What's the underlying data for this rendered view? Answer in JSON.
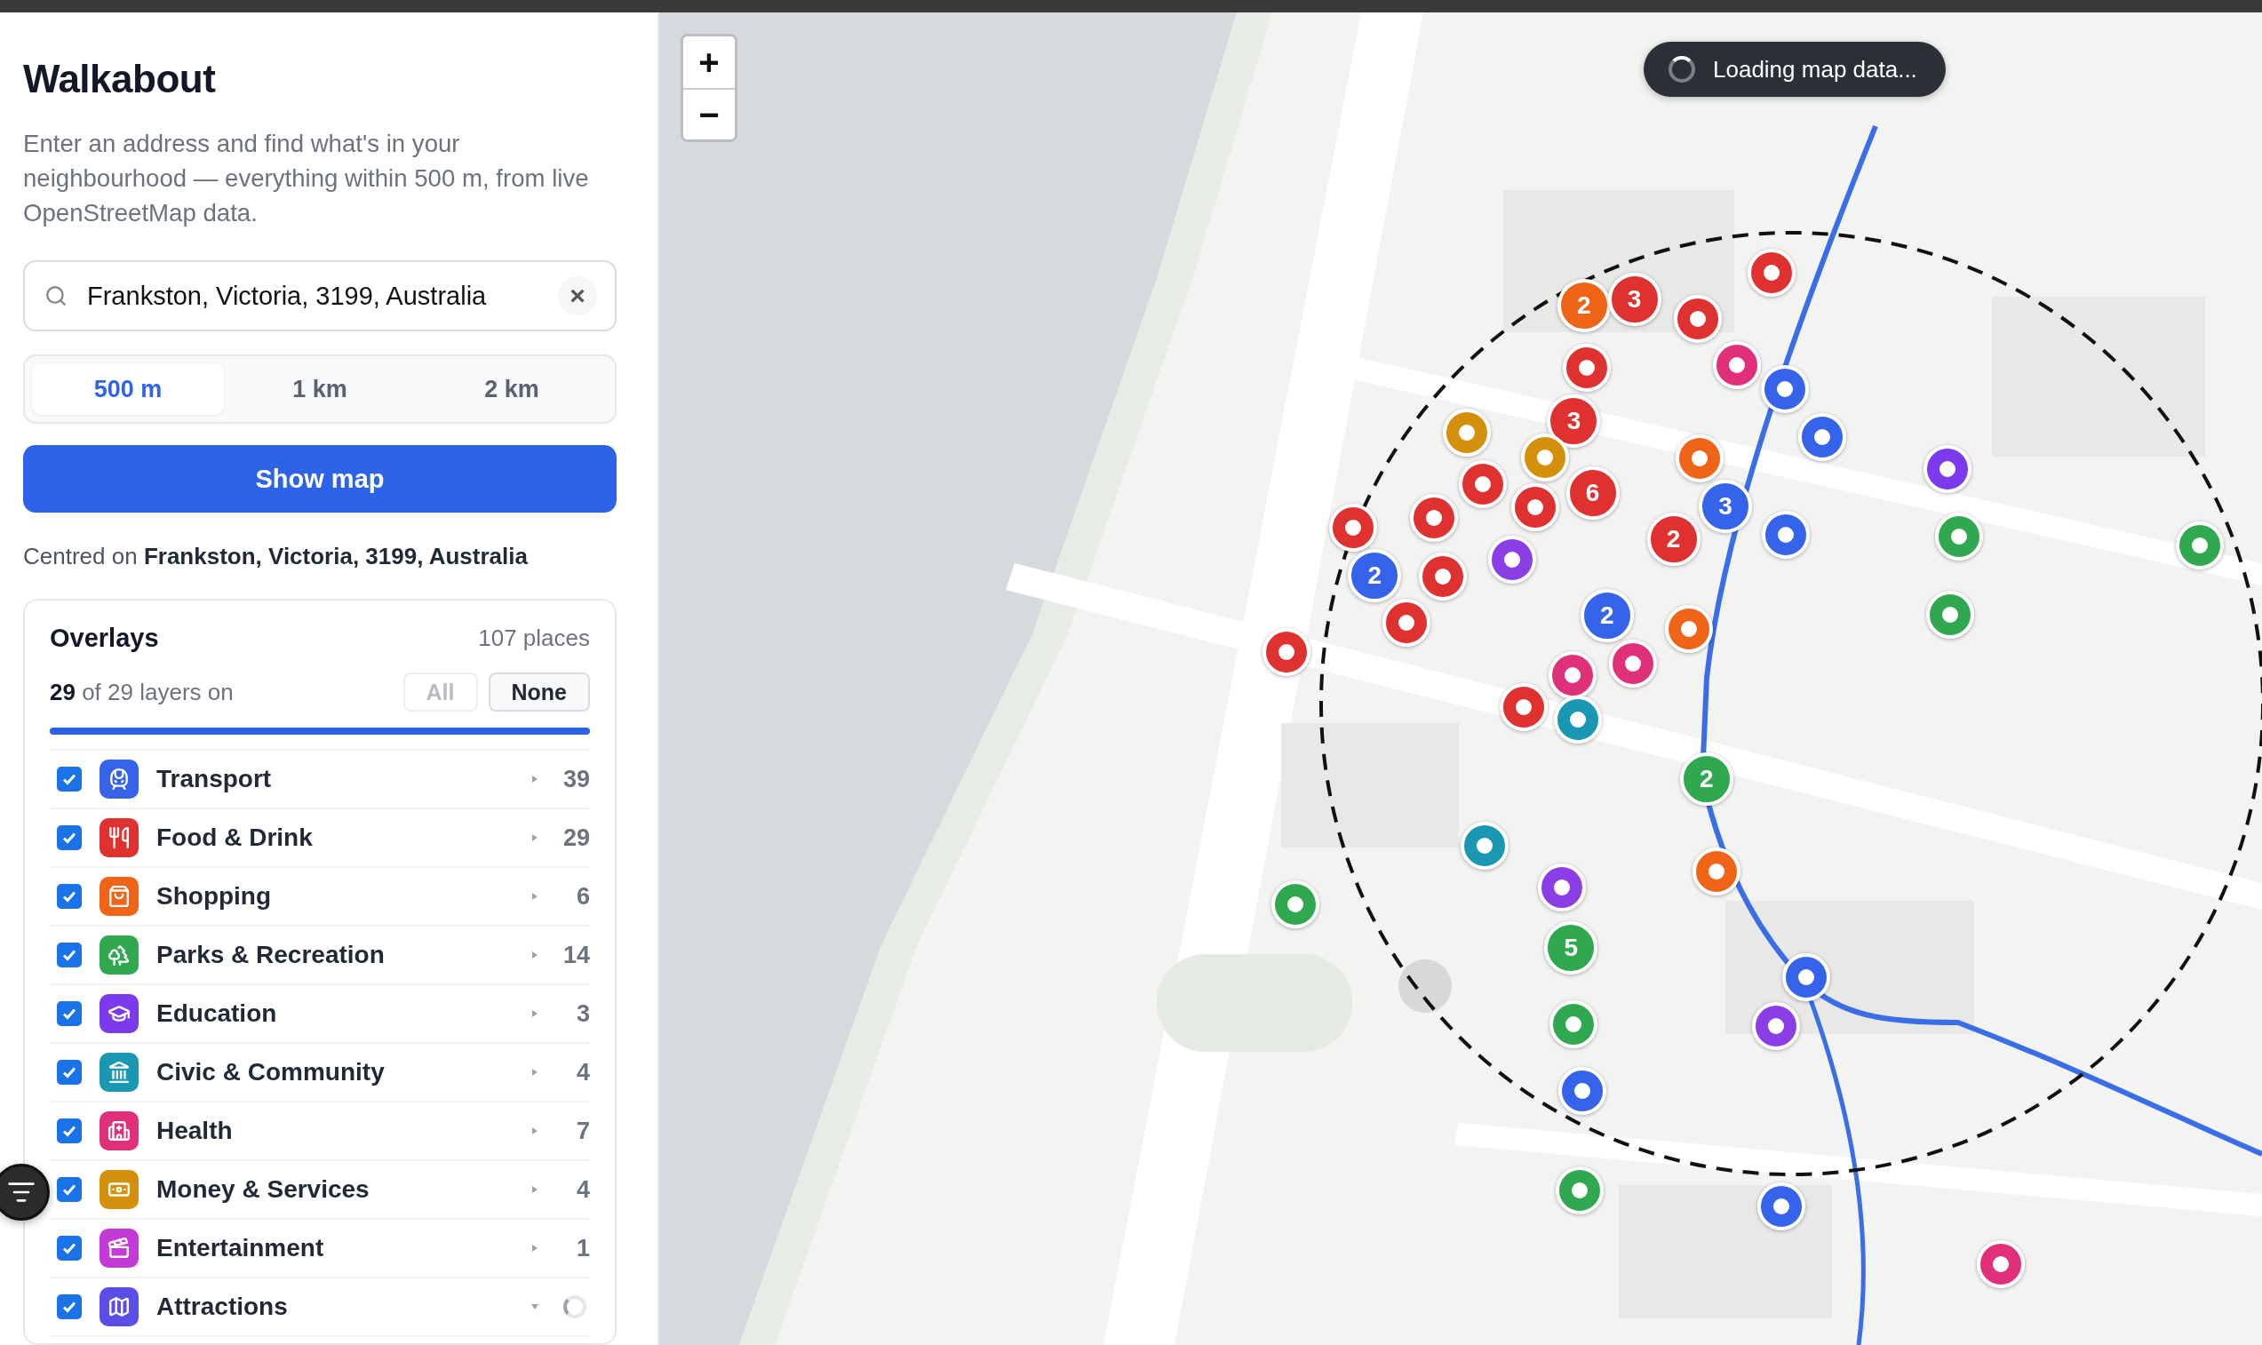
{
  "app": {
    "title": "Walkabout",
    "description": "Enter an address and find what's in your neighbourhood — everything within 500 m, from live OpenStreetMap data."
  },
  "search": {
    "value": "Frankston, Victoria, 3199, Australia",
    "clear": "×"
  },
  "ranges": [
    {
      "label": "500 m",
      "selected": true
    },
    {
      "label": "1 km",
      "selected": false
    },
    {
      "label": "2 km",
      "selected": false
    }
  ],
  "show_button": "Show map",
  "centred": "Centred on **Frankston, Victoria, 3199, Australia**",
  "overlays": {
    "title": "Overlays",
    "count": "107 places",
    "summary": "**29** of 29 layers on",
    "level": 1,
    "buttons": [
      {
        "label": "All",
        "disabled": true
      },
      {
        "label": "None",
        "disabled": false
      }
    ],
    "layers": [
      {
        "name": "Transport",
        "checked": true,
        "expanded": false,
        "count": "39",
        "color": "#3563e9"
      },
      {
        "name": "Food & Drink",
        "checked": true,
        "expanded": false,
        "count": "29",
        "color": "#e03131"
      },
      {
        "name": "Shopping",
        "checked": true,
        "expanded": false,
        "count": "6",
        "color": "#f06418"
      },
      {
        "name": "Parks & Recreation",
        "checked": true,
        "expanded": false,
        "count": "14",
        "color": "#2fa84f"
      },
      {
        "name": "Education",
        "checked": true,
        "expanded": false,
        "count": "3",
        "color": "#7c3aed"
      },
      {
        "name": "Civic & Community",
        "checked": true,
        "expanded": false,
        "count": "4",
        "color": "#1a98b3"
      },
      {
        "name": "Health",
        "checked": true,
        "expanded": false,
        "count": "7",
        "color": "#e0307a"
      },
      {
        "name": "Money & Services",
        "checked": true,
        "expanded": false,
        "count": "4",
        "color": "#d4900b"
      },
      {
        "name": "Entertainment",
        "checked": true,
        "expanded": false,
        "count": "1",
        "color": "#c43ad6"
      },
      {
        "name": "Attractions",
        "checked": true,
        "expanded": true,
        "loading": true,
        "color": "#5b4ee6"
      }
    ]
  },
  "map": {
    "zoom_in": "+",
    "zoom_out": "−",
    "loading": "Loading map data...",
    "markers": [
      {
        "kind": "poi",
        "color": "#e03131"
      },
      {
        "kind": "cluster",
        "count": "2",
        "color": "#f06418"
      },
      {
        "kind": "cluster",
        "count": "3",
        "color": "#e03131"
      },
      {
        "kind": "poi",
        "color": "#e03131"
      },
      {
        "kind": "poi",
        "color": "#e03131"
      },
      {
        "kind": "cluster",
        "count": "3",
        "color": "#e03131"
      },
      {
        "kind": "poi",
        "color": "#e0307a"
      },
      {
        "kind": "poi",
        "color": "#3563e9"
      },
      {
        "kind": "poi",
        "color": "#3563e9"
      },
      {
        "kind": "poi",
        "color": "#d4900b"
      },
      {
        "kind": "poi",
        "color": "#d4900b"
      },
      {
        "kind": "cluster",
        "count": "6",
        "color": "#e03131"
      },
      {
        "kind": "poi",
        "color": "#e03131"
      },
      {
        "kind": "poi",
        "color": "#e03131"
      },
      {
        "kind": "poi",
        "color": "#8b3ee6"
      },
      {
        "kind": "poi",
        "color": "#f06418"
      },
      {
        "kind": "cluster",
        "count": "3",
        "color": "#3563e9"
      },
      {
        "kind": "cluster",
        "count": "2",
        "color": "#e03131"
      },
      {
        "kind": "poi",
        "color": "#3563e9"
      },
      {
        "kind": "poi",
        "color": "#e03131"
      },
      {
        "kind": "poi",
        "color": "#e03131"
      },
      {
        "kind": "cluster",
        "count": "2",
        "color": "#3563e9"
      },
      {
        "kind": "poi",
        "color": "#e03131"
      },
      {
        "kind": "poi",
        "color": "#e03131"
      },
      {
        "kind": "poi",
        "color": "#e03131"
      },
      {
        "kind": "cluster",
        "count": "2",
        "color": "#3563e9"
      },
      {
        "kind": "poi",
        "color": "#e0307a"
      },
      {
        "kind": "poi",
        "color": "#e0307a"
      },
      {
        "kind": "poi",
        "color": "#f06418"
      },
      {
        "kind": "poi",
        "color": "#e03131"
      },
      {
        "kind": "poi",
        "color": "#1a98b3"
      },
      {
        "kind": "cluster",
        "count": "2",
        "color": "#2fa84f"
      },
      {
        "kind": "poi",
        "color": "#1a98b3"
      },
      {
        "kind": "poi",
        "color": "#f06418"
      },
      {
        "kind": "poi",
        "color": "#8b3ee6"
      },
      {
        "kind": "cluster",
        "count": "5",
        "color": "#2fa84f"
      },
      {
        "kind": "poi",
        "color": "#2fa84f"
      },
      {
        "kind": "poi",
        "color": "#2fa84f"
      },
      {
        "kind": "poi",
        "color": "#8b3ee6"
      },
      {
        "kind": "poi",
        "color": "#3563e9"
      },
      {
        "kind": "poi",
        "color": "#3563e9"
      },
      {
        "kind": "poi",
        "color": "#2fa84f"
      },
      {
        "kind": "poi",
        "color": "#3563e9"
      },
      {
        "kind": "poi",
        "color": "#e0307a"
      },
      {
        "kind": "poi",
        "color": "#7c3aed"
      },
      {
        "kind": "poi",
        "color": "#2fa84f"
      },
      {
        "kind": "poi",
        "color": "#2fa84f"
      },
      {
        "kind": "poi",
        "color": "#2fa84f"
      }
    ]
  }
}
